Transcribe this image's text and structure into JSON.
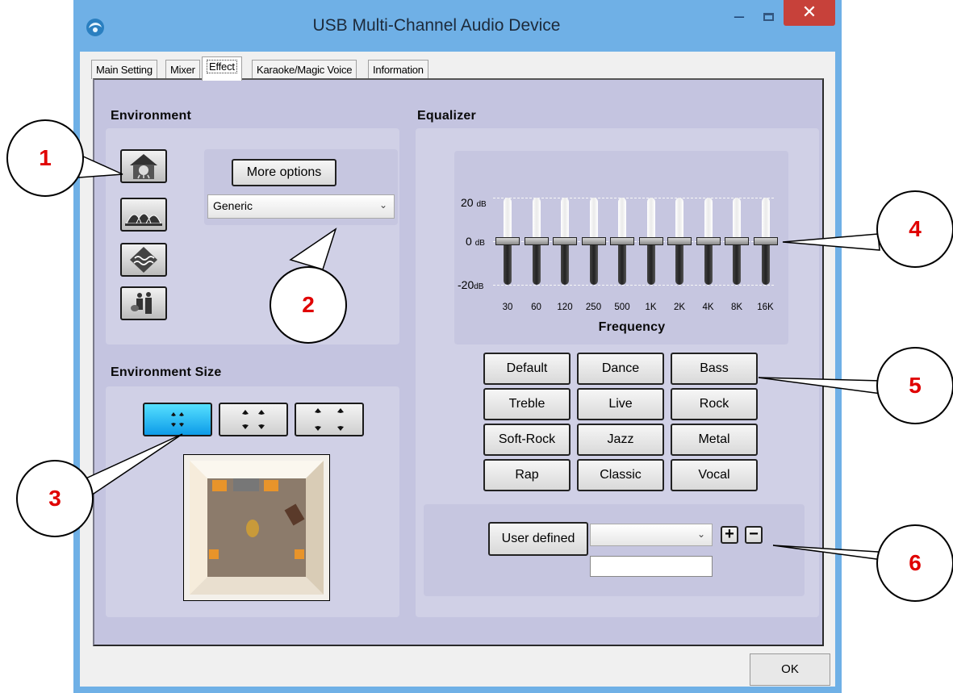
{
  "window": {
    "title": "USB Multi-Channel Audio Device",
    "minimize_glyph": "–",
    "close_glyph": "✕"
  },
  "tabs": [
    {
      "label": "Main Setting",
      "active": false
    },
    {
      "label": "Mixer",
      "active": false
    },
    {
      "label": "Effect",
      "active": true
    },
    {
      "label": "Karaoke/Magic Voice",
      "active": false
    },
    {
      "label": "Information",
      "active": false
    }
  ],
  "environment": {
    "heading": "Environment",
    "icons": [
      "bathroom-icon",
      "opera-house-icon",
      "underwater-icon",
      "band-icon"
    ],
    "more_options_label": "More options",
    "preset_value": "Generic"
  },
  "environment_size": {
    "heading": "Environment Size",
    "selected_index": 0
  },
  "equalizer": {
    "heading": "Equalizer",
    "db_labels": [
      {
        "value": "20",
        "unit": "dB"
      },
      {
        "value": "0",
        "unit": "dB"
      },
      {
        "value": "-20",
        "unit": "dB"
      }
    ],
    "frequencies": [
      "30",
      "60",
      "120",
      "250",
      "500",
      "1K",
      "2K",
      "4K",
      "8K",
      "16K"
    ],
    "gains_db": [
      0,
      0,
      0,
      0,
      0,
      0,
      0,
      0,
      0,
      0
    ],
    "gain_range_db": [
      -20,
      20
    ],
    "frequency_label": "Frequency",
    "presets": [
      [
        "Default",
        "Dance",
        "Bass"
      ],
      [
        "Treble",
        "Live",
        "Rock"
      ],
      [
        "Soft-Rock",
        "Jazz",
        "Metal"
      ],
      [
        "Rap",
        "Classic",
        "Vocal"
      ]
    ],
    "user_defined_label": "User defined",
    "user_select_value": "",
    "user_name_value": "",
    "add_glyph": "+",
    "remove_glyph": "−"
  },
  "callouts": [
    "1",
    "2",
    "3",
    "4",
    "5",
    "6"
  ],
  "ok_label": "OK"
}
